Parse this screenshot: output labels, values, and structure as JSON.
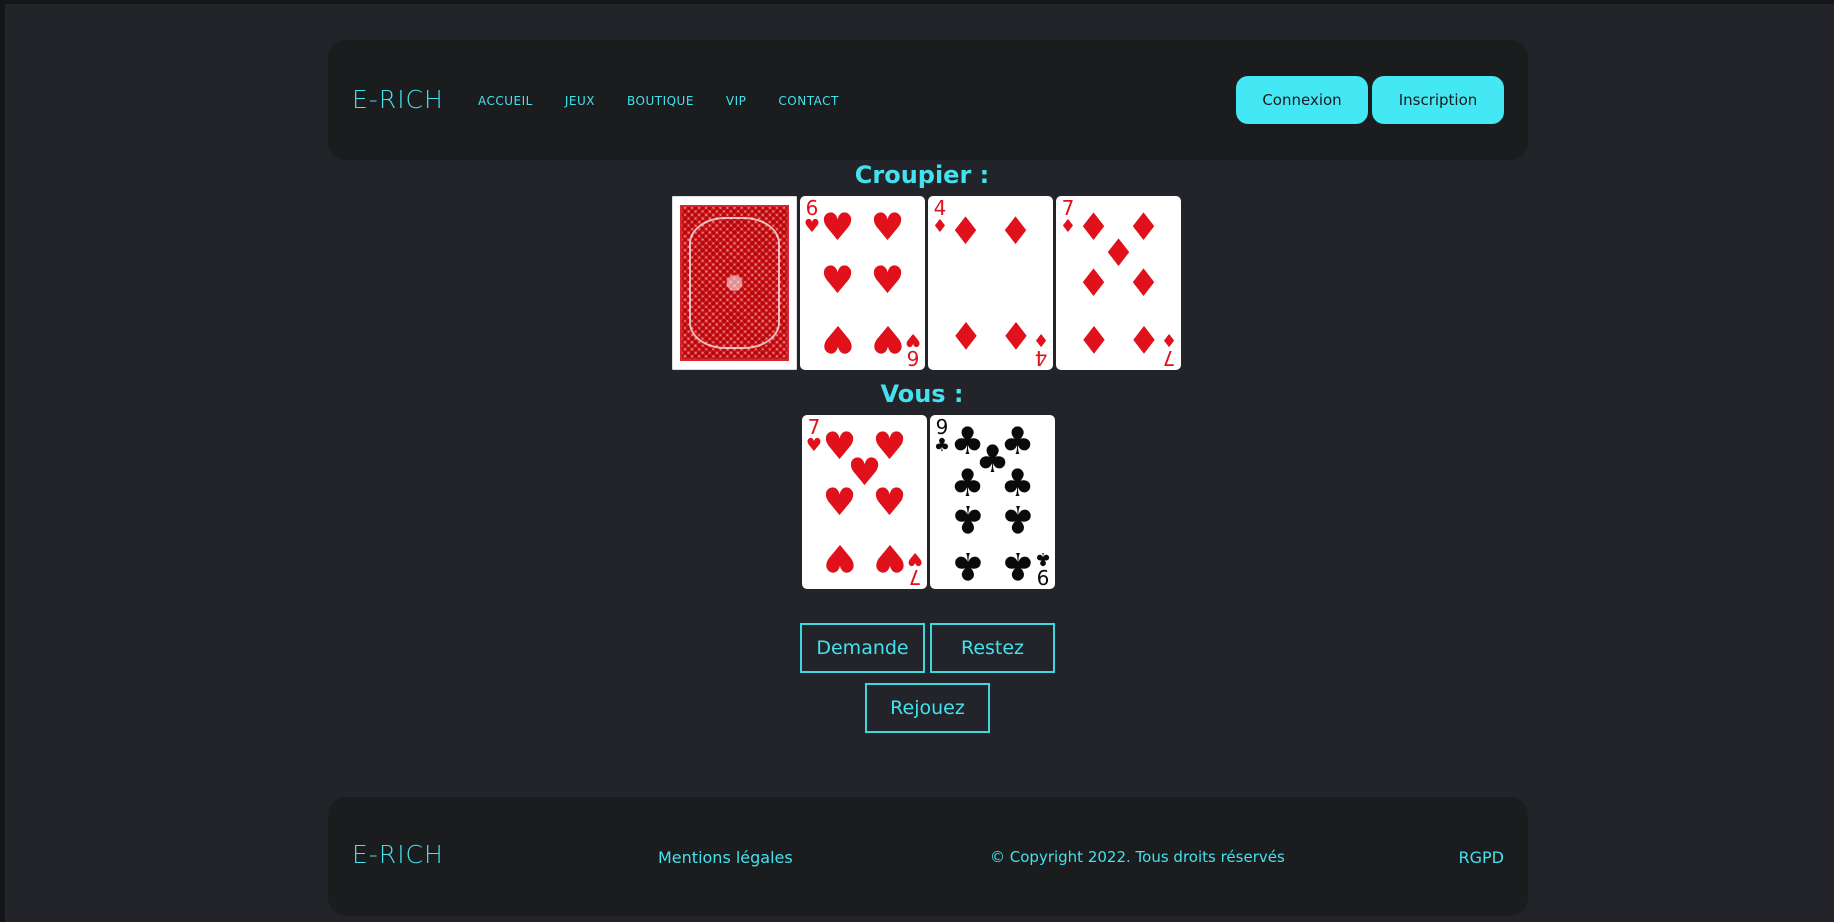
{
  "header": {
    "logo": "E-RICH",
    "nav": [
      "ACCUEIL",
      "JEUX",
      "BOUTIQUE",
      "VIP",
      "CONTACT"
    ],
    "login_label": "Connexion",
    "signup_label": "Inscription"
  },
  "game": {
    "dealer_title": "Croupier :",
    "player_title": "Vous :",
    "dealer_cards": [
      {
        "face": "back"
      },
      {
        "rank": "6",
        "suit": "♥",
        "color": "red"
      },
      {
        "rank": "4",
        "suit": "♦",
        "color": "red"
      },
      {
        "rank": "7",
        "suit": "♦",
        "color": "red"
      }
    ],
    "player_cards": [
      {
        "rank": "7",
        "suit": "♥",
        "color": "red"
      },
      {
        "rank": "9",
        "suit": "♣",
        "color": "black"
      }
    ],
    "hit_label": "Demande",
    "stand_label": "Restez",
    "replay_label": "Rejouez"
  },
  "footer": {
    "logo": "E-RICH",
    "legal_label": "Mentions légales",
    "copyright": "© Copyright 2022. Tous droits réservés",
    "rgpd_label": "RGPD"
  },
  "colors": {
    "accent": "#44e1ee",
    "background": "#222429",
    "panel": "#1b1c1e"
  }
}
